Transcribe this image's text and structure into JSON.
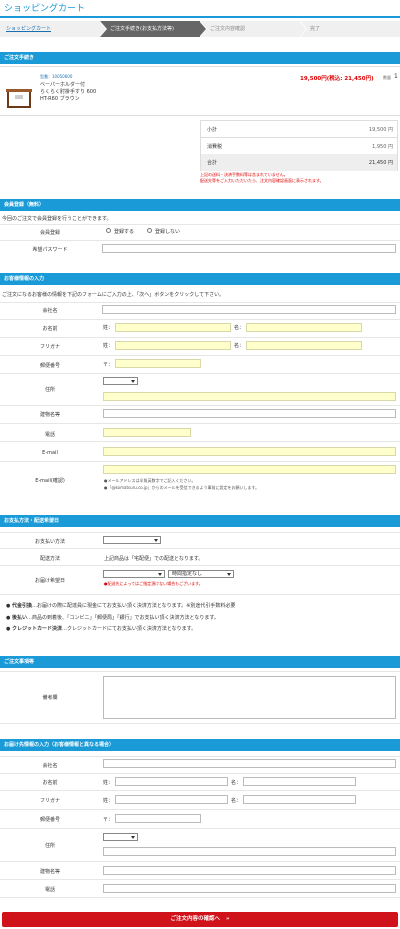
{
  "app": {
    "title": "ショッピングカート"
  },
  "steps": [
    {
      "label": "ショッピングカート"
    },
    {
      "label": "ご注文手続き(お支払方法等)"
    },
    {
      "label": "ご注文内容確認"
    },
    {
      "label": "完了"
    }
  ],
  "order": {
    "heading": "ご注文手続き",
    "item_code": "型番：10050600",
    "name_l1": "ベーパーホルダー付",
    "name_l2": "らくらく肘掛手すり 600",
    "name_l3": "HT-R60 ブラウン",
    "price": "19,500円(税込: 21,450円)",
    "qty_label": "数量",
    "qty": "1",
    "subtotal_label": "小計",
    "subtotal": "19,500 円",
    "tax_label": "消費税",
    "tax": "1,950 円",
    "total_label": "合計",
    "total": "21,450 円",
    "note1": "上記の送料・決済手数料等は含まれていません。",
    "note2": "配送先等をご入力いただいたら、注文内容確認画面に表示されます。"
  },
  "member": {
    "heading": "会員登録（無料）",
    "intro": "今回のご注文で会員登録を行うことができます。",
    "reg_label": "会員登録",
    "opt_yes": "登録する",
    "opt_no": "登録しない",
    "pw_label": "希望パスワード"
  },
  "customer": {
    "heading": "お客様情報の入力",
    "intro": "ご注文になるお客様の情報を下記のフォームにご入力の上、「次へ」ボタンをクリックして下さい。",
    "company": "会社名",
    "name": "お名前",
    "kana": "フリガナ",
    "sei": "姓：",
    "mei": "名：",
    "zip": "郵便番号",
    "zip_mark": "〒：",
    "address": "住所",
    "building": "建物名等",
    "tel": "電話",
    "email": "E-mail",
    "email2": "E-mail(確認)",
    "email_note1": "●メールアドレスは半角英数字でご記入ください。",
    "email_note2": "●「@komatsuru.co.jp」からのメールを受信できるよう事前に設定をお願いします。"
  },
  "payment": {
    "heading": "お支払方法・配送希望日",
    "method_label": "お支払い方法",
    "delivery_label": "配送方法",
    "delivery_text": "上記商品は「宅配便」での配送となります。",
    "date_label": "お届け希望日",
    "time_default": "時間指定なし",
    "date_note": "●配送先によってはご指定頂けない場合もございます。",
    "b1_title": "代金引換",
    "b1_text": "…お届けの際に配達員に現金にてお支払い頂く決済方法となります。※別途代引手数料必要",
    "b2_title": "後払い",
    "b2_text": "…商品の到着後、「コンビニ」「郵便局」「銀行」でお支払い頂く決済方法となります。",
    "b3_title": "クレジットカード決済",
    "b3_text": "…クレジットカードにてお支払い頂く決済方法となります。"
  },
  "remarks": {
    "heading": "ご注文事項等",
    "label": "備考欄"
  },
  "shipping": {
    "heading": "お届け先情報の入力（お客様情報と異なる場合）",
    "company": "会社名",
    "name": "お名前",
    "kana": "フリガナ",
    "sei": "姓：",
    "mei": "名：",
    "zip": "郵便番号",
    "zip_mark": "〒：",
    "address": "住所",
    "building": "建物名等",
    "tel": "電話"
  },
  "submit": {
    "label": "ご注文内容の確認へ",
    "arrow": "»"
  },
  "colors": {
    "accent": "#1a9ad6",
    "input_required": "#ffffcc",
    "submit": "#d0121b"
  }
}
